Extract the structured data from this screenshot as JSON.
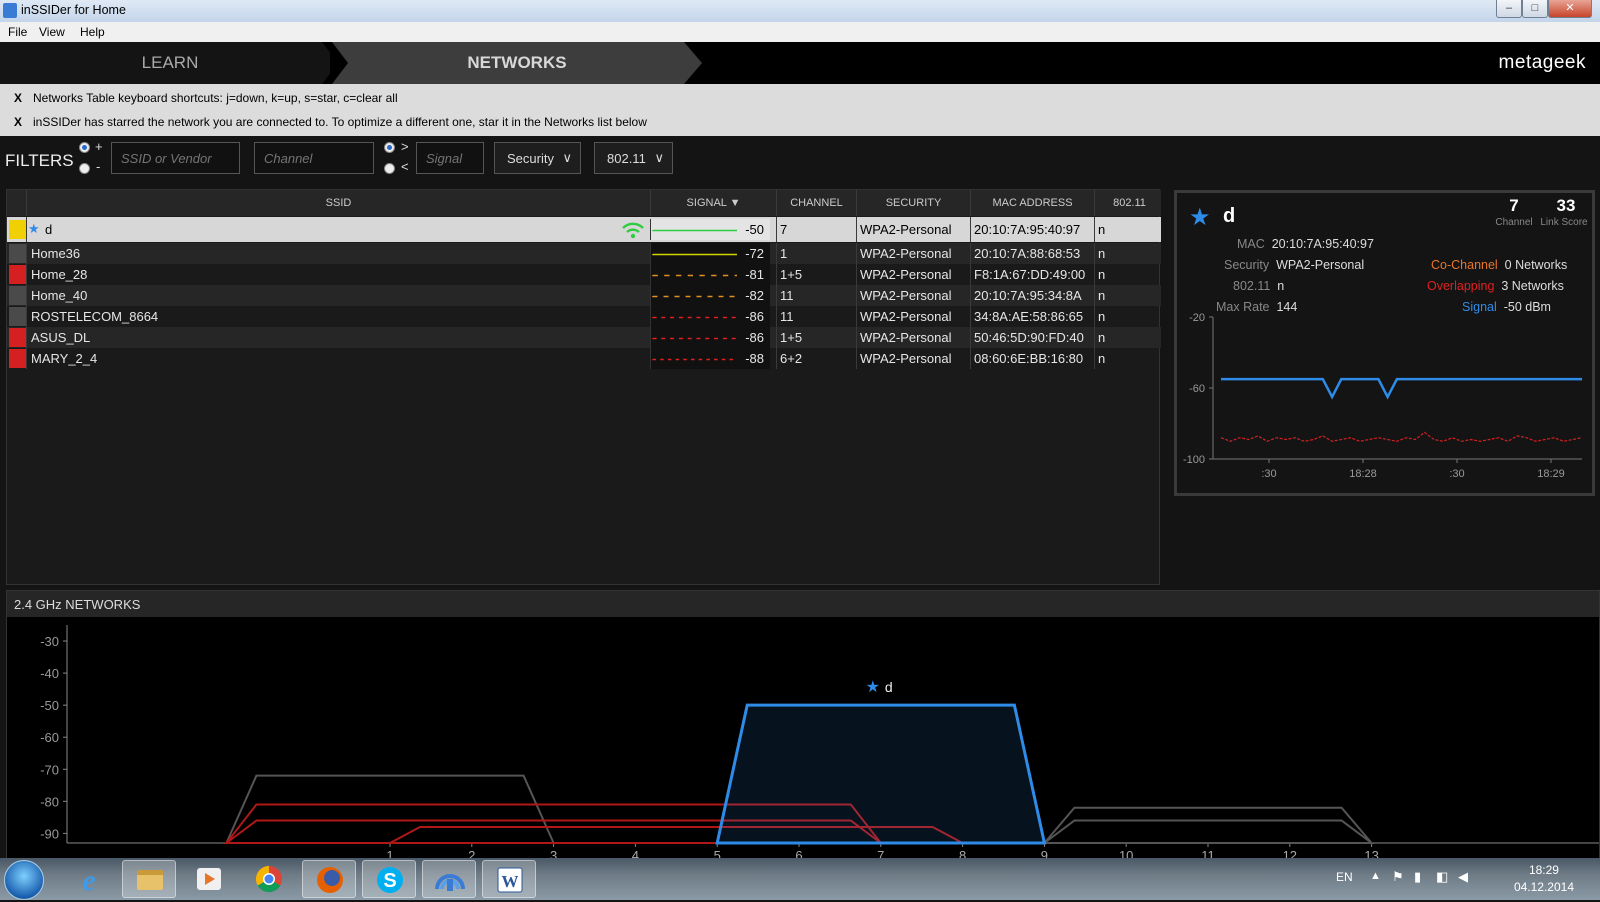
{
  "window": {
    "title": "inSSIDer for Home"
  },
  "menu": [
    "File",
    "View",
    "Help"
  ],
  "nav": {
    "learn": "LEARN",
    "networks": "NETWORKS",
    "brand": "metageek"
  },
  "notices": [
    "Networks Table keyboard shortcuts: j=down, k=up, s=star, c=clear all",
    "inSSIDer has starred the network you are connected to. To optimize a different one, star it in the Networks list below"
  ],
  "filters": {
    "label": "FILTERS",
    "plus": "+",
    "minus": "-",
    "gt": ">",
    "lt": "<",
    "ssid_placeholder": "SSID or Vendor",
    "channel_placeholder": "Channel",
    "signal_placeholder": "Signal",
    "security": "Security",
    "mode": "802.11"
  },
  "table": {
    "columns": {
      "ssid": "SSID",
      "signal": "SIGNAL",
      "channel": "CHANNEL",
      "security": "SECURITY",
      "mac": "MAC ADDRESS",
      "mode": "802.11"
    },
    "rows": [
      {
        "ssid": "d",
        "signal": "-50",
        "channel": "7",
        "security": "WPA2-Personal",
        "mac": "20:10:7A:95:40:97",
        "mode": "n",
        "color": "#f0d000",
        "starred": true,
        "line_color": "#2ecc40"
      },
      {
        "ssid": "Home36",
        "signal": "-72",
        "channel": "1",
        "security": "WPA2-Personal",
        "mac": "20:10:7A:88:68:53",
        "mode": "n",
        "color": "#4a4a4a",
        "line_color": "#d4d400"
      },
      {
        "ssid": "Home_28",
        "signal": "-81",
        "channel": "1+5",
        "security": "WPA2-Personal",
        "mac": "F8:1A:67:DD:49:00",
        "mode": "n",
        "color": "#d42020",
        "line_color": "#e09020"
      },
      {
        "ssid": "Home_40",
        "signal": "-82",
        "channel": "11",
        "security": "WPA2-Personal",
        "mac": "20:10:7A:95:34:8A",
        "mode": "n",
        "color": "#4a4a4a",
        "line_color": "#e09020"
      },
      {
        "ssid": "ROSTELECOM_8664",
        "signal": "-86",
        "channel": "11",
        "security": "WPA2-Personal",
        "mac": "34:8A:AE:58:86:65",
        "mode": "n",
        "color": "#4a4a4a",
        "line_color": "#e02020"
      },
      {
        "ssid": "ASUS_DL",
        "signal": "-86",
        "channel": "1+5",
        "security": "WPA2-Personal",
        "mac": "50:46:5D:90:FD:40",
        "mode": "n",
        "color": "#d42020",
        "line_color": "#e02020"
      },
      {
        "ssid": "MARY_2_4",
        "signal": "-88",
        "channel": "6+2",
        "security": "WPA2-Personal",
        "mac": "08:60:6E:BB:16:80",
        "mode": "n",
        "color": "#d42020",
        "line_color": "#e02020"
      }
    ]
  },
  "detail": {
    "name": "d",
    "channel": "7",
    "channel_label": "Channel",
    "link_score": "33",
    "link_score_label": "Link Score",
    "mac_label": "MAC",
    "mac": "20:10:7A:95:40:97",
    "security_label": "Security",
    "security": "WPA2-Personal",
    "mode_label": "802.11",
    "mode": "n",
    "maxrate_label": "Max Rate",
    "maxrate": "144",
    "cochannel_label": "Co-Channel",
    "cochannel": "0 Networks",
    "overlapping_label": "Overlapping",
    "overlapping": "3 Networks",
    "signal_label": "Signal",
    "signal": "-50 dBm"
  },
  "chart_data": [
    {
      "type": "line",
      "x": [
        ":30",
        "18:28",
        ":30",
        "18:29"
      ],
      "y_ticks": [
        "-20",
        "-60",
        "-100"
      ],
      "ylim": [
        -100,
        -20
      ],
      "series": [
        {
          "color": "#2f8be8",
          "values": [
            -55,
            -55,
            -55,
            -55,
            -55,
            -55,
            -55,
            -55,
            -55,
            -55,
            -55,
            -55,
            -65,
            -55,
            -55,
            -55,
            -55,
            -55,
            -65,
            -55,
            -55,
            -55,
            -55,
            -55,
            -55,
            -55,
            -55,
            -55,
            -55,
            -55,
            -55,
            -55,
            -55,
            -55,
            -55,
            -55,
            -55,
            -55,
            -55,
            -55
          ]
        },
        {
          "color": "#d42020",
          "values": [
            -88,
            -90,
            -88,
            -89,
            -87,
            -90,
            -88,
            -89,
            -88,
            -90,
            -89,
            -87,
            -90,
            -89,
            -88,
            -90,
            -89,
            -88,
            -89,
            -90,
            -88,
            -89,
            -85,
            -89,
            -90,
            -88,
            -90,
            -89,
            -90,
            -89,
            -88,
            -90,
            -87,
            -88,
            -90,
            -89,
            -88,
            -90,
            -89,
            -88
          ]
        }
      ]
    },
    {
      "type": "area",
      "title": "2.4 GHz NETWORKS",
      "x_ticks": [
        "1",
        "2",
        "3",
        "4",
        "5",
        "6",
        "7",
        "8",
        "9",
        "10",
        "11",
        "12",
        "13"
      ],
      "y_ticks": [
        "-30",
        "-40",
        "-50",
        "-60",
        "-70",
        "-80",
        "-90"
      ],
      "ylim": [
        -93,
        -25
      ],
      "networks": [
        {
          "name": "d",
          "from_ch": 5,
          "to_ch": 9,
          "signal": -50,
          "color": "#2f8be8",
          "label": "d"
        },
        {
          "name": "Home36",
          "from_ch": -1,
          "to_ch": 3,
          "signal": -72,
          "color": "#555555"
        },
        {
          "name": "Home_28",
          "from_ch": -1,
          "to_ch": 7,
          "signal": -81,
          "color": "#b01818"
        },
        {
          "name": "ASUS_DL",
          "from_ch": -1,
          "to_ch": 7,
          "signal": -86,
          "color": "#b01818"
        },
        {
          "name": "MARY_2_4",
          "from_ch": 1,
          "to_ch": 8,
          "signal": -88,
          "color": "#b01818"
        },
        {
          "name": "Home_40",
          "from_ch": 9,
          "to_ch": 13,
          "signal": -82,
          "color": "#555555"
        },
        {
          "name": "ROSTELECOM_8664",
          "from_ch": 9,
          "to_ch": 13,
          "signal": -86,
          "color": "#555555"
        }
      ]
    }
  ],
  "taskbar": {
    "lang": "EN",
    "time": "18:29",
    "date": "04.12.2014"
  }
}
